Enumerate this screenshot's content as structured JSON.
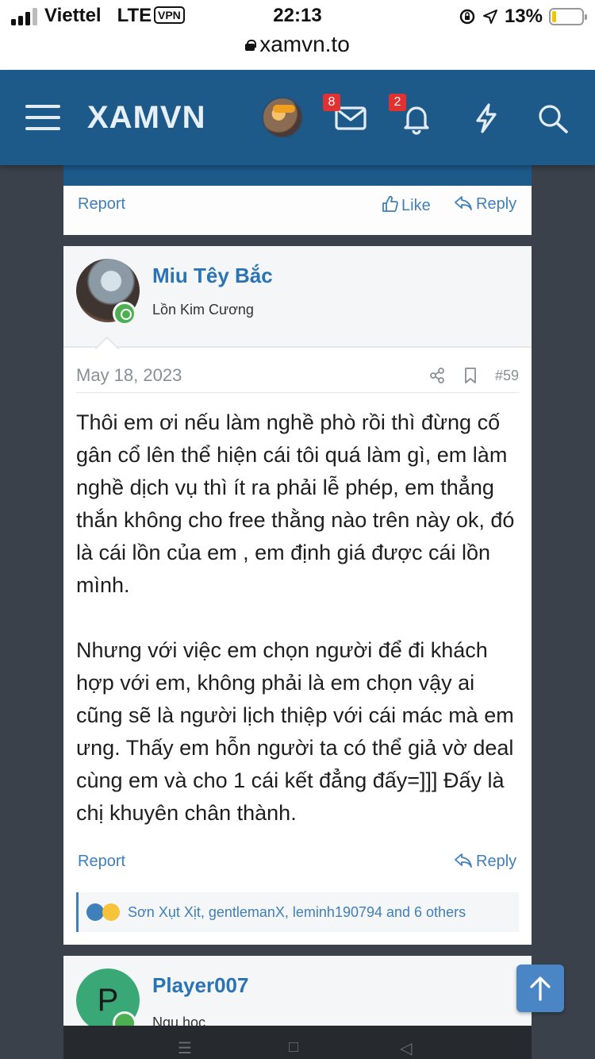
{
  "status_bar": {
    "carrier": "Viettel",
    "network": "LTE",
    "vpn_label": "VPN",
    "time": "22:13",
    "battery_percent": "13%",
    "battery_level": 0.13,
    "url": "xamvn.to"
  },
  "header": {
    "logo": "XAMVN",
    "messages_badge": "8",
    "alerts_badge": "2"
  },
  "prev_post": {
    "report_label": "Report",
    "like_label": "Like",
    "reply_label": "Reply"
  },
  "post": {
    "username": "Miu Têy Bắc",
    "user_title": "Lồn Kim Cương",
    "date": "May 18, 2023",
    "post_number": "#59",
    "body": [
      "Thôi em ơi nếu làm nghề phò rồi thì đừng cố gân cổ lên thể hiện cái tôi quá làm gì, em làm nghề dịch vụ thì ít ra phải lễ phép, em thẳng thắn không cho free thằng nào trên này ok, đó là cái lồn của em , em định giá được cái lồn mình.",
      "Nhưng với việc em chọn người để đi khách hợp với em, không phải là em chọn vậy ai cũng sẽ là người lịch thiệp với cái mác mà em ưng. Thấy em hỗn người ta có thể giả vờ deal cùng em và cho 1 cái kết đẳng đấy=]]] Đấy là chị khuyên chân thành."
    ],
    "report_label": "Report",
    "reply_label": "Reply",
    "reactions_text": "Sơn Xụt Xịt, gentlemanX, leminh190794 and 6 others"
  },
  "next_post": {
    "avatar_letter": "P",
    "username": "Player007",
    "user_title": "Ngu học"
  },
  "colors": {
    "header_bg": "#1d5a8a",
    "link": "#3f7fba",
    "username": "#2a73b5",
    "badge": "#e03232",
    "online": "#4caf50"
  }
}
